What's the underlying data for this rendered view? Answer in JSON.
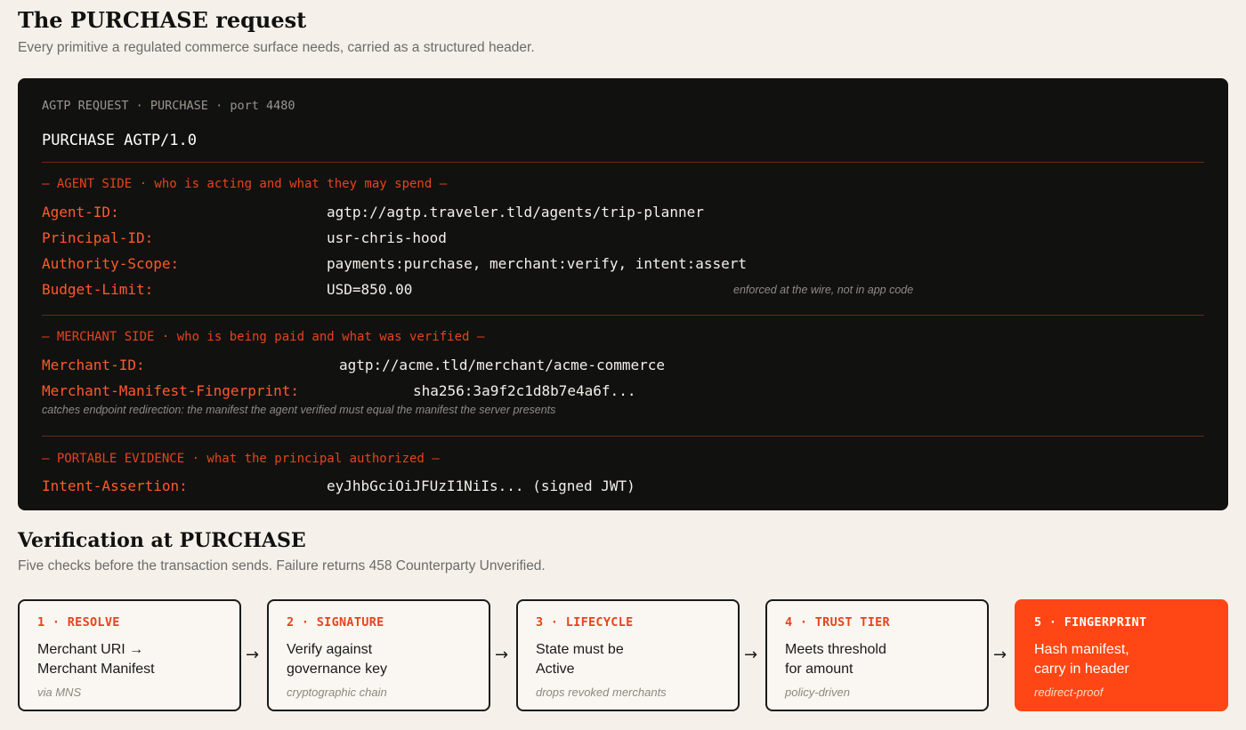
{
  "header": {
    "title": "The PURCHASE request",
    "subtitle": "Every primitive a regulated commerce surface needs, carried as a structured header."
  },
  "request": {
    "label": "AGTP REQUEST · PURCHASE · port 4480",
    "line": "PURCHASE AGTP/1.0",
    "agent_section": {
      "label": "— AGENT SIDE · who is acting and what they may spend —",
      "fields": [
        {
          "key": "Agent-ID:",
          "value": "agtp://agtp.traveler.tld/agents/trip-planner"
        },
        {
          "key": "Principal-ID:",
          "value": "usr-chris-hood"
        },
        {
          "key": "Authority-Scope:",
          "value": "payments:purchase, merchant:verify, intent:assert"
        },
        {
          "key": "Budget-Limit:",
          "value": "USD=850.00",
          "note": "enforced at the wire, not in app code"
        }
      ]
    },
    "merchant_section": {
      "label": "— MERCHANT SIDE · who is being paid and what was verified —",
      "fields": [
        {
          "key": "Merchant-ID:",
          "value": "agtp://acme.tld/merchant/acme-commerce"
        },
        {
          "key": "Merchant-Manifest-Fingerprint:",
          "value": "sha256:3a9f2c1d8b7e4a6f..."
        }
      ],
      "note": "catches endpoint redirection: the manifest the agent verified must equal the manifest the server presents"
    },
    "evidence_section": {
      "label": "— PORTABLE EVIDENCE · what the principal authorized —",
      "fields": [
        {
          "key": "Intent-Assertion:",
          "value": "eyJhbGciOiJFUzI1NiIs... (signed JWT)"
        }
      ]
    }
  },
  "verification": {
    "title": "Verification at PURCHASE",
    "subtitle": "Five checks before the transaction sends. Failure returns 458 Counterparty Unverified.",
    "arrow_glyph": "→",
    "steps": [
      {
        "number": "1 · RESOLVE",
        "body": "Merchant URI →\nMerchant Manifest",
        "foot": "via MNS"
      },
      {
        "number": "2 · SIGNATURE",
        "body": "Verify against\ngovernance key",
        "foot": "cryptographic chain"
      },
      {
        "number": "3 · LIFECYCLE",
        "body": "State must be\nActive",
        "foot": "drops revoked merchants"
      },
      {
        "number": "4 · TRUST TIER",
        "body": "Meets threshold\nfor amount",
        "foot": "policy-driven"
      },
      {
        "number": "5 · FINGERPRINT",
        "body": "Hash manifest,\ncarry in header",
        "foot": "redirect-proof"
      }
    ]
  },
  "colors": {
    "background": "#f5f1ea",
    "panel": "#111110",
    "accent": "#ff4614",
    "key": "#ff5a2a"
  }
}
